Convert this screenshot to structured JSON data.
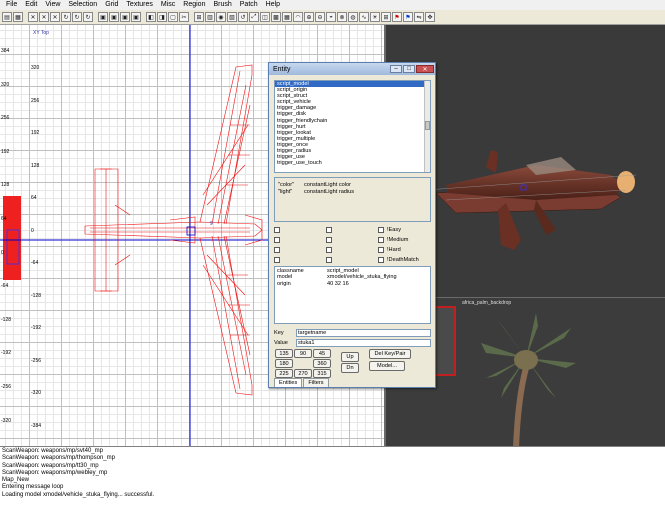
{
  "menu": [
    "File",
    "Edit",
    "View",
    "Selection",
    "Grid",
    "Textures",
    "Misc",
    "Region",
    "Brush",
    "Patch",
    "Help"
  ],
  "toolbar": {
    "buttons": [
      {
        "icon": "open-icon",
        "glyph": "▤"
      },
      {
        "icon": "save-icon",
        "glyph": "▦"
      },
      {
        "icon": "flip-x-icon",
        "glyph": "✕"
      },
      {
        "icon": "flip-y-icon",
        "glyph": "✕"
      },
      {
        "icon": "flip-z-icon",
        "glyph": "✕"
      },
      {
        "icon": "rotate-x-icon",
        "glyph": "↻"
      },
      {
        "icon": "rotate-y-icon",
        "glyph": "↻"
      },
      {
        "icon": "rotate-z-icon",
        "glyph": "↻"
      },
      {
        "icon": "select-complete-icon",
        "glyph": "▣"
      },
      {
        "icon": "select-touching-icon",
        "glyph": "▣"
      },
      {
        "icon": "select-partial-icon",
        "glyph": "▣"
      },
      {
        "icon": "select-inside-icon",
        "glyph": "▣"
      },
      {
        "icon": "csg-subtract-icon",
        "glyph": "◧"
      },
      {
        "icon": "csg-merge-icon",
        "glyph": "◨"
      },
      {
        "icon": "hollow-icon",
        "glyph": "▢"
      },
      {
        "icon": "clipper-icon",
        "glyph": "✂"
      },
      {
        "icon": "change-views-icon",
        "glyph": "⊞"
      },
      {
        "icon": "texture-view-icon",
        "glyph": "▥"
      },
      {
        "icon": "camera-icon",
        "glyph": "◉"
      },
      {
        "icon": "entity-view-icon",
        "glyph": "▧"
      },
      {
        "icon": "free-rotation-icon",
        "glyph": "↺"
      },
      {
        "icon": "free-scaling-icon",
        "glyph": "⤢"
      },
      {
        "icon": "show-patches-icon",
        "glyph": "◫"
      },
      {
        "icon": "cubic-clip-icon",
        "glyph": "▩"
      },
      {
        "icon": "patch-icon",
        "glyph": "▦"
      },
      {
        "icon": "patch-bend-icon",
        "glyph": "◠"
      },
      {
        "icon": "patch-insert-icon",
        "glyph": "⊕"
      },
      {
        "icon": "patch-delete-icon",
        "glyph": "⊖"
      },
      {
        "icon": "patch-cap-icon",
        "glyph": "◒"
      },
      {
        "icon": "patch-weld-icon",
        "glyph": "⊗"
      },
      {
        "icon": "patch-drill-icon",
        "glyph": "◍"
      },
      {
        "icon": "smooth-icon",
        "glyph": "∿"
      },
      {
        "icon": "lightmaps-icon",
        "glyph": "☀"
      },
      {
        "icon": "grid-snap-icon",
        "glyph": "⊞"
      },
      {
        "icon": "red-flag-icon",
        "glyph": "⚑",
        "color": "#cc0000"
      },
      {
        "icon": "blue-flag-icon",
        "glyph": "⚑",
        "color": "#0033cc"
      },
      {
        "icon": "mirror-icon",
        "glyph": "⇋"
      },
      {
        "icon": "pivot-icon",
        "glyph": "✥"
      }
    ]
  },
  "grid": {
    "view_label": "XY Top",
    "ticks_left": [
      "384",
      "320",
      "256",
      "192",
      "128",
      "64",
      "0",
      "-64",
      "-128",
      "-192",
      "-256",
      "-320",
      "-384"
    ],
    "ticks_top": [
      "-384",
      "-320",
      "-256",
      "-192",
      "-128",
      "-64",
      "0",
      "64",
      "128",
      "192",
      "256",
      "320"
    ],
    "ticks_right_col": [
      "320",
      "256",
      "192",
      "128",
      "64",
      "0",
      "-64",
      "-128",
      "-192",
      "-256",
      "-320",
      "-384"
    ],
    "sidebar_ticks": [
      "384",
      "320",
      "256",
      "192",
      "128",
      "64",
      "0",
      "-64",
      "-128",
      "-192",
      "-256",
      "-320"
    ],
    "origin_marker": "9"
  },
  "texture": {
    "name": "africa_palm_backdrop"
  },
  "entity": {
    "title": "Entity",
    "min_glyph": "–",
    "max_glyph": "□",
    "close_glyph": "✕",
    "classes": [
      "script_model",
      "script_origin",
      "script_struct",
      "script_vehicle",
      "trigger_damage",
      "trigger_disk",
      "trigger_friendlychain",
      "trigger_hurt",
      "trigger_lookat",
      "trigger_multiple",
      "trigger_once",
      "trigger_radius",
      "trigger_use",
      "trigger_use_touch"
    ],
    "selected_class": "script_model",
    "description": [
      {
        "key": "\"color\"",
        "value": "constantLight color"
      },
      {
        "key": "\"light\"",
        "value": "constantLight radius"
      }
    ],
    "flags": [
      {
        "label": "",
        "checked": false
      },
      {
        "label": "",
        "checked": false
      },
      {
        "label": "!Easy",
        "checked": false
      },
      {
        "label": "",
        "checked": false
      },
      {
        "label": "",
        "checked": false
      },
      {
        "label": "!Medium",
        "checked": false
      },
      {
        "label": "",
        "checked": false
      },
      {
        "label": "",
        "checked": false
      },
      {
        "label": "!Hard",
        "checked": false
      },
      {
        "label": "",
        "checked": false
      },
      {
        "label": "",
        "checked": false
      },
      {
        "label": "!DeathMatch",
        "checked": false
      }
    ],
    "keyvalues": [
      {
        "key": "classname",
        "value": "script_model"
      },
      {
        "key": "model",
        "value": "xmodel/vehicle_stuka_flying"
      },
      {
        "key": "origin",
        "value": "40 32 16"
      }
    ],
    "key_label": "Key",
    "key_value": "targetname",
    "value_label": "Value",
    "value_value": "stuka1",
    "angles": [
      "135",
      "90",
      "45",
      "180",
      "360",
      "225",
      "270",
      "315"
    ],
    "up_label": "Up",
    "dn_label": "Dn",
    "delkey_label": "Del Key/Pair",
    "model_label": "Model...",
    "tabs": [
      "Entities",
      "Filters"
    ]
  },
  "console": [
    "ScanWeapon: weapons/mp/svt40_mp",
    "ScanWeapon: weapons/mp/thompson_mp",
    "ScanWeapon: weapons/mp/tt30_mp",
    "ScanWeapon: weapons/mp/webley_mp",
    "Map_New",
    "Entering message loop",
    "Loading model xmodel/vehicle_stuka_flying... successful."
  ]
}
